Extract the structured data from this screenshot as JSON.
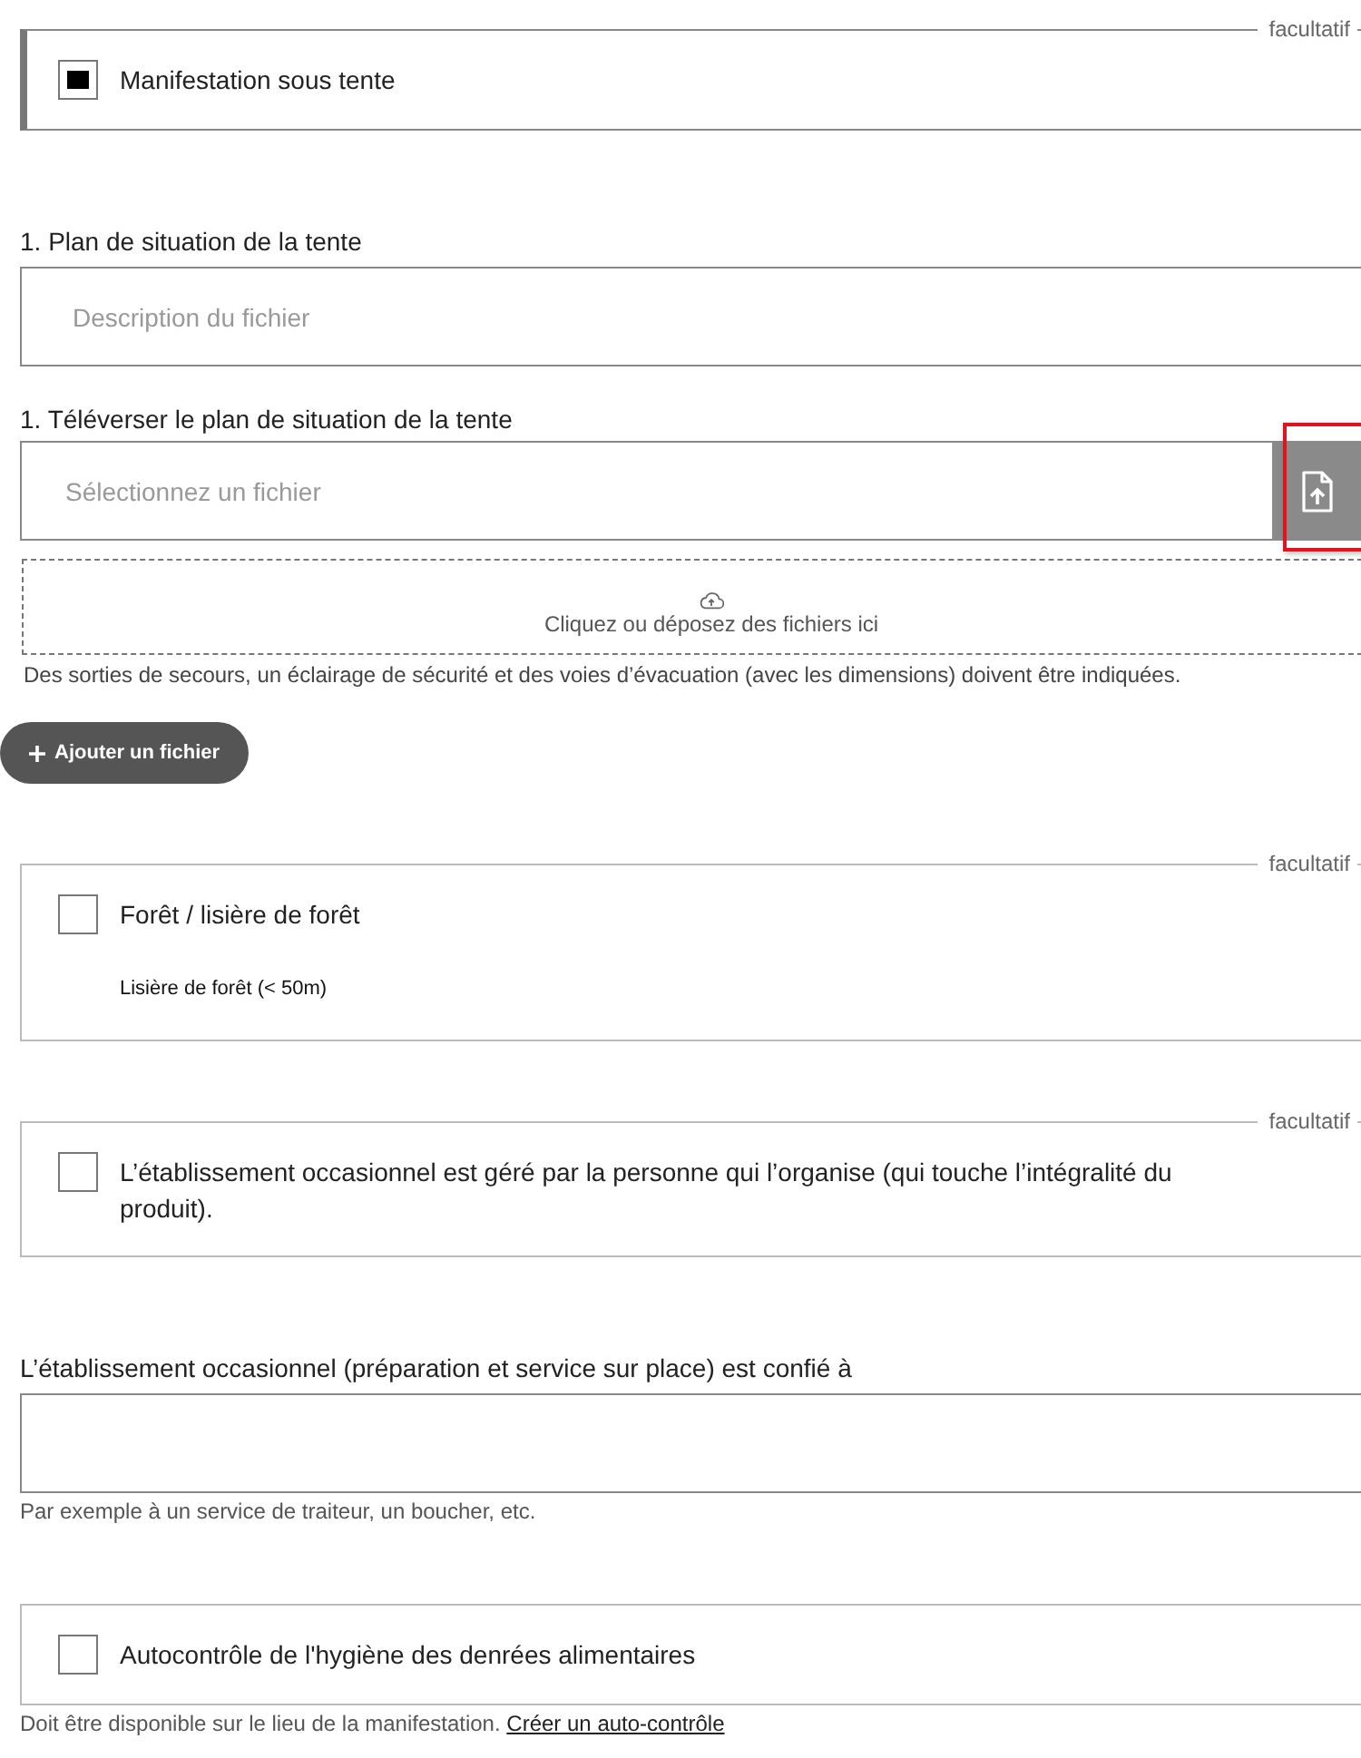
{
  "sections": [
    {
      "kind": "option",
      "optional_label": "facultatif",
      "checked": true,
      "label": "Manifestation sous tente"
    },
    {
      "kind": "text-input",
      "label": "1. Plan de situation de la tente",
      "placeholder": "Description du fichier"
    },
    {
      "kind": "file-upload",
      "label": "1. Téléverser le plan de situation de la tente",
      "placeholder": "Sélectionnez un fichier",
      "highlighted": true,
      "dropzone_text": "Cliquez ou déposez des fichiers ici",
      "hint": "Des sorties de secours, un éclairage de sécurité et des voies d’évacuation (avec les dimensions) doivent être indiquées.",
      "add_button": "Ajouter un fichier"
    },
    {
      "kind": "option",
      "optional_label": "facultatif",
      "checked": false,
      "label": "Forêt / lisière de forêt",
      "note": "Lisière de forêt (< 50m)"
    },
    {
      "kind": "option",
      "optional_label": "facultatif",
      "checked": false,
      "label": "L’établissement occasionnel est géré par la personne qui l’organise (qui touche l’intégralité du produit)."
    },
    {
      "kind": "text-input",
      "label": "L’établissement occasionnel (préparation et service sur place) est confié à",
      "hint": "Par exemple à un service de traiteur, un boucher, etc."
    },
    {
      "kind": "option",
      "checked": false,
      "label": "Autocontrôle de l'hygiène des denrées alimentaires",
      "hint": "Doit être disponible sur le lieu de la manifestation.",
      "link": "Créer un auto-contrôle"
    }
  ]
}
